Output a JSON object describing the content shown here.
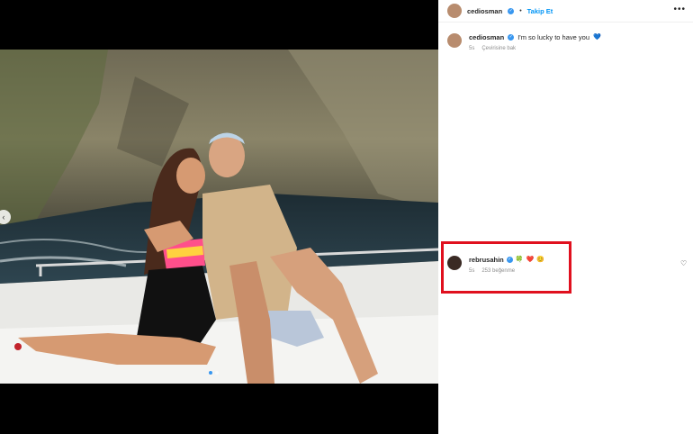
{
  "post": {
    "author": "cediosman",
    "follow_label": "Takip Et",
    "separator": "•",
    "more_label": "•••"
  },
  "caption": {
    "username": "cediosman",
    "text": "I'm so lucky to have you",
    "emoji": "💙",
    "time": "5s",
    "translate": "Çevirisine bak"
  },
  "comment": {
    "username": "rebrusahin",
    "emojis": [
      "🍀",
      "❤️",
      "😊"
    ],
    "time": "5s",
    "likes": "253 beğenme"
  },
  "media": {
    "prev_icon": "‹",
    "slide_count": 2,
    "active_slide": 1
  },
  "colors": {
    "link": "#0095f6",
    "verified": "#3897f0",
    "highlight": "#e0101e"
  }
}
